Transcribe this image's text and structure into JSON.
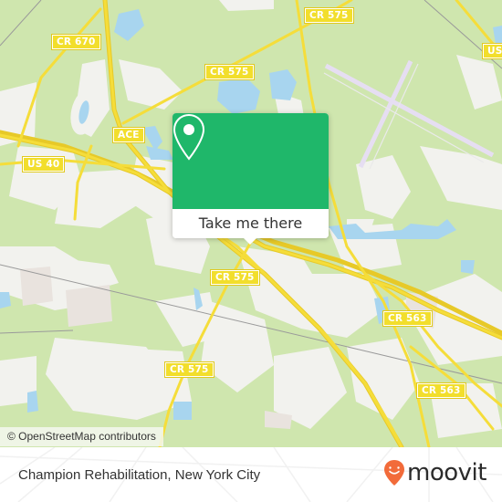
{
  "map": {
    "colors": {
      "land": "#cfe6ae",
      "urban": "#f2f2ee",
      "water": "#a8d5ef",
      "road": "#f5dd3a",
      "runway": "#e6def2"
    },
    "road_labels": [
      {
        "id": "cr670",
        "text": "CR 670"
      },
      {
        "id": "cr575-north",
        "text": "CR 575"
      },
      {
        "id": "cr575-top",
        "text": "CR 575"
      },
      {
        "id": "ace",
        "text": "ACE"
      },
      {
        "id": "us40",
        "text": "US 40"
      },
      {
        "id": "us-top-right",
        "text": "US"
      },
      {
        "id": "cr575-center",
        "text": "CR 575"
      },
      {
        "id": "cr575-south",
        "text": "CR 575"
      },
      {
        "id": "cr563-east",
        "text": "CR 563"
      },
      {
        "id": "cr563-southeast",
        "text": "CR 563"
      }
    ],
    "attribution": "© OpenStreetMap contributors"
  },
  "popup": {
    "icon": "map-pin-icon",
    "action_label": "Take me there",
    "accent": "#1fb76a"
  },
  "footer": {
    "place_name": "Champion Rehabilitation, New York City",
    "brand": "moovit",
    "brand_color": "#f26b3a"
  }
}
